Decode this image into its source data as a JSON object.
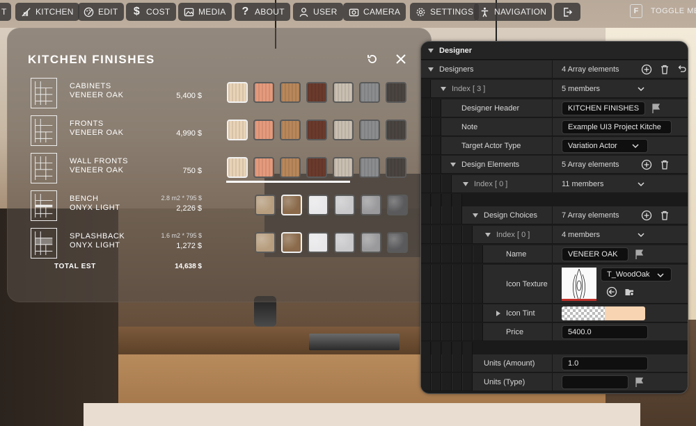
{
  "toolbar": {
    "items": [
      {
        "label": "KITCHEN",
        "icon": "kitchen-icon"
      },
      {
        "label": "EDIT",
        "icon": "palette-icon"
      },
      {
        "label": "COST",
        "icon": "dollar-icon"
      },
      {
        "label": "MEDIA",
        "icon": "image-icon"
      },
      {
        "label": "ABOUT",
        "icon": "question-icon"
      },
      {
        "label": "USER",
        "icon": "user-icon"
      },
      {
        "label": "CAMERA",
        "icon": "camera-icon"
      },
      {
        "label": "SETTINGS",
        "icon": "gear-icon"
      },
      {
        "label": "NAVIGATION",
        "icon": "person-icon"
      }
    ],
    "exit_icon": "exit-icon",
    "toggle_key": "F",
    "toggle_label": "TOGGLE ME"
  },
  "finishes": {
    "title": "KITCHEN FINISHES",
    "rows": [
      {
        "line1": "CABINETS",
        "line2": "VENEER OAK",
        "qty": "",
        "price": "5,400 $"
      },
      {
        "line1": "FRONTS",
        "line2": "VENEER OAK",
        "qty": "",
        "price": "4,990 $"
      },
      {
        "line1": "WALL FRONTS",
        "line2": "VENEER OAK",
        "qty": "",
        "price": "750 $"
      },
      {
        "line1": "BENCH",
        "line2": "ONYX LIGHT",
        "qty": "2.8 m2 * 795 $",
        "price": "2,226 $"
      },
      {
        "line1": "SPLASHBACK",
        "line2": "ONYX LIGHT",
        "qty": "1.6 m2 * 795 $",
        "price": "1,272 $"
      }
    ],
    "total_label": "TOTAL EST",
    "total_value": "14,638 $",
    "wood_colors": [
      "#e9d3b6",
      "#e59a7c",
      "#b8875a",
      "#6a3a2c",
      "#c9bfb1",
      "#8a8c8e",
      "#4a4440"
    ],
    "stone_colors": [
      "#b79e7f",
      "#8a6a4a",
      "#e8e8ea",
      "#c9c9cb",
      "#9a9a9c",
      "#5a5a5c"
    ]
  },
  "designer": {
    "title": "Designer",
    "rows": {
      "designers_label": "Designers",
      "designers_val": "4 Array elements",
      "index3_label": "Index [ 3 ]",
      "index3_val": "5 members",
      "header_label": "Designer Header",
      "header_val": "KITCHEN FINISHES",
      "note_label": "Note",
      "note_val": "Example UI3 Project Kitche",
      "target_label": "Target Actor Type",
      "target_val": "Variation Actor",
      "elements_label": "Design Elements",
      "elements_val": "5 Array elements",
      "index0_label": "Index [ 0 ]",
      "index0_val": "11 members",
      "choices_label": "Design Choices",
      "choices_val": "7 Array elements",
      "index0b_label": "Index [ 0 ]",
      "index0b_val": "4 members",
      "name_label": "Name",
      "name_val": "VENEER OAK",
      "icon_texture_label": "Icon Texture",
      "icon_texture_val": "T_WoodOak",
      "icon_tint_label": "Icon Tint",
      "tint_color": "#f8d4b2",
      "price_label": "Price",
      "price_val": "5400.0",
      "units_amount_label": "Units (Amount)",
      "units_amount_val": "1.0",
      "units_type_label": "Units (Type)",
      "units_type_val": ""
    }
  }
}
